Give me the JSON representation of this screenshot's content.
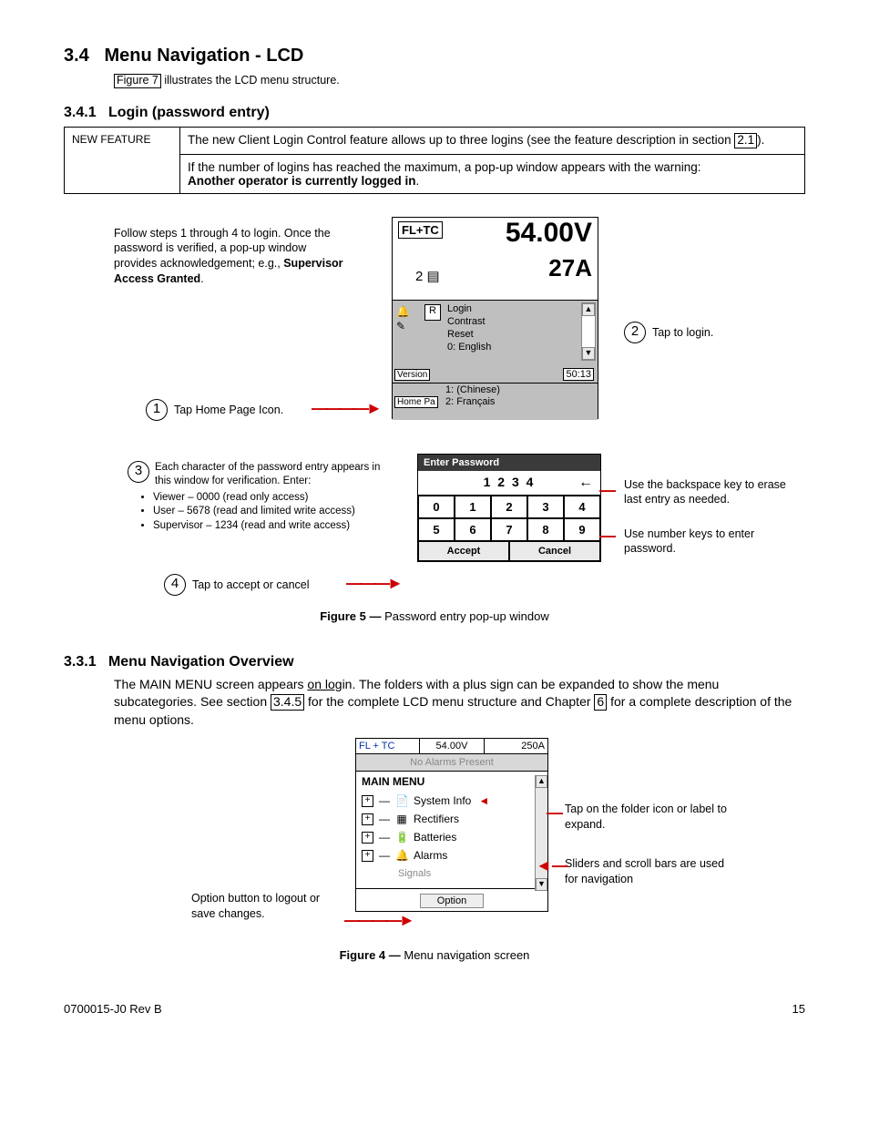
{
  "s34": {
    "num": "3.4",
    "title": "Menu Navigation - LCD",
    "intro_pre": "Figure 7",
    "intro_post": " illustrates the LCD menu structure."
  },
  "s341": {
    "num": "3.4.1",
    "title": "Login (password entry)"
  },
  "feature": {
    "label": "NEW FEATURE",
    "p1a": "The new Client Login Control feature allows up to three logins  (see the feature description in section ",
    "p1ref": "2.1",
    "p1b": ").",
    "p2": "If the number of logins has reached the maximum, a pop-up window appears with the warning:",
    "p2b": "Another operator is currently logged in"
  },
  "loginSteps": {
    "text1": "Follow steps 1 through 4 to login. Once the password is verified, a pop-up window provides acknowledgement; e.g., ",
    "text1b": "Supervisor Access Granted",
    "step1": "Tap Home Page Icon.",
    "step2": "Tap to login.",
    "step3a": "Each character of the password entry appears in this window for verification. Enter:",
    "step3b1": "Viewer – 0000 (read only access)",
    "step3b2": "User – 5678 (read and limited write access)",
    "step3b3": "Supervisor – 1234 (read and write access)",
    "step4": "Tap to accept or cancel"
  },
  "lcd": {
    "fltc": "FL+TC",
    "icon2": "2 ▤",
    "volt": "54.00V",
    "amp": "27A",
    "r": "R",
    "m1": "Login",
    "m2": "Contrast",
    "m3": "Reset",
    "m4": "0: English",
    "m5": "1: (Chinese)",
    "m6": "2: Français",
    "time": "50:13",
    "ver": "Version",
    "home": "Home Pa"
  },
  "pwd": {
    "header": "Enter Password",
    "display": "1 2 3 4",
    "bs": "←",
    "k0": "0",
    "k1": "1",
    "k2": "2",
    "k3": "3",
    "k4": "4",
    "k5": "5",
    "k6": "6",
    "k7": "7",
    "k8": "8",
    "k9": "9",
    "accept": "Accept",
    "cancel": "Cancel",
    "anno_bs": "Use the  backspace key to erase last entry as needed.",
    "anno_num": "Use number keys to enter password."
  },
  "fig5": {
    "label": "Figure 5  —  ",
    "text": "Password entry pop-up window"
  },
  "s331": {
    "num": "3.3.1",
    "title": "Menu Navigation Overview",
    "p_a": "The MAIN MENU screen appears ",
    "p_b": "on log",
    "p_c": "in. The folders with a plus sign can be expanded to show the menu subcategories. See section ",
    "ref1": "3.4.5",
    "p_d": " for the complete LCD menu structure and Chapter ",
    "ref2": "6",
    "p_e": " for a complete description of the menu options."
  },
  "menu": {
    "fltc": "FL + TC",
    "v": "54.00V",
    "a": "250A",
    "noalarms": "No Alarms Present",
    "mm": "MAIN MENU",
    "i1": "System Info",
    "i2": "Rectifiers",
    "i3": "Batteries",
    "i4": "Alarms",
    "i5": "Signals",
    "opt": "Option",
    "anno1": "Tap on the folder icon or label to expand.",
    "anno2": "Sliders and scroll bars are used for navigation",
    "anno3": "Option button to logout or save changes."
  },
  "fig4": {
    "label": "Figure 4  —  ",
    "text": "Menu navigation screen"
  },
  "footer": {
    "left": "0700015-J0    Rev B",
    "right": "15"
  }
}
